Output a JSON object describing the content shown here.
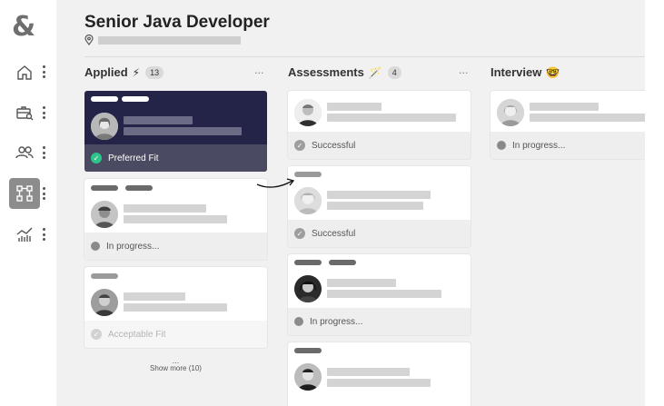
{
  "app": {
    "logo": "&"
  },
  "sidebar": {
    "items": [
      {
        "icon": "home-icon"
      },
      {
        "icon": "briefcase-search-icon"
      },
      {
        "icon": "people-icon"
      },
      {
        "icon": "workflow-icon",
        "active": true
      },
      {
        "icon": "analytics-icon"
      }
    ]
  },
  "job": {
    "title": "Senior Java Developer",
    "location_icon": "location-pin-icon"
  },
  "columns": [
    {
      "title": "Applied",
      "emoji": "⚡",
      "count": "13",
      "cards": [
        {
          "status": "Preferred Fit",
          "style": "dark"
        },
        {
          "status": "In progress..."
        },
        {
          "status": "Acceptable Fit"
        }
      ],
      "show_more": "Show more (10)"
    },
    {
      "title": "Assessments",
      "emoji": "🪄",
      "count": "4",
      "cards": [
        {
          "status": "Successful"
        },
        {
          "status": "Successful"
        },
        {
          "status": "In progress..."
        },
        {
          "status": ""
        }
      ]
    },
    {
      "title": "Interview",
      "emoji": "🤓",
      "cards": [
        {
          "status": "In progress..."
        }
      ]
    }
  ],
  "column_menu_label": "···",
  "colors": {
    "dark_card": "#242449",
    "success": "#2cc48a",
    "accent": "#8c8c8c"
  }
}
